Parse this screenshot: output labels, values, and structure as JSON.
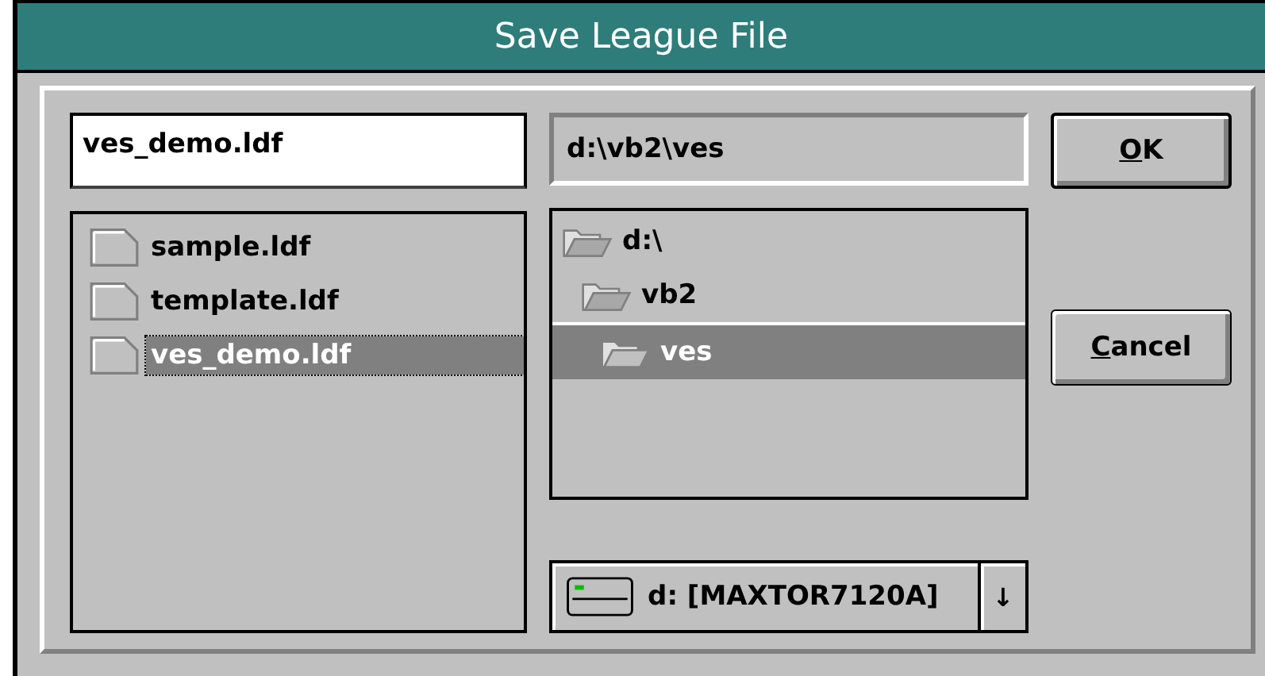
{
  "window": {
    "title": "Save League File"
  },
  "file_name": {
    "value": "ves_demo.ldf"
  },
  "current_path": "d:\\vb2\\ves",
  "files": [
    {
      "name": "sample.ldf",
      "selected": false
    },
    {
      "name": "template.ldf",
      "selected": false
    },
    {
      "name": "ves_demo.ldf",
      "selected": true
    }
  ],
  "folders": [
    {
      "name": "d:\\",
      "selected": false,
      "children": [
        {
          "name": "vb2",
          "selected": false,
          "children": [
            {
              "name": "ves",
              "selected": true
            }
          ]
        }
      ]
    }
  ],
  "buttons": [
    {
      "access_key": "O",
      "label_rest": "K",
      "default": true
    },
    {
      "access_key": "C",
      "label_rest": "ancel",
      "default": false
    }
  ],
  "drive": {
    "value": "d: [MAXTOR7120A]",
    "arrow": "↓"
  }
}
